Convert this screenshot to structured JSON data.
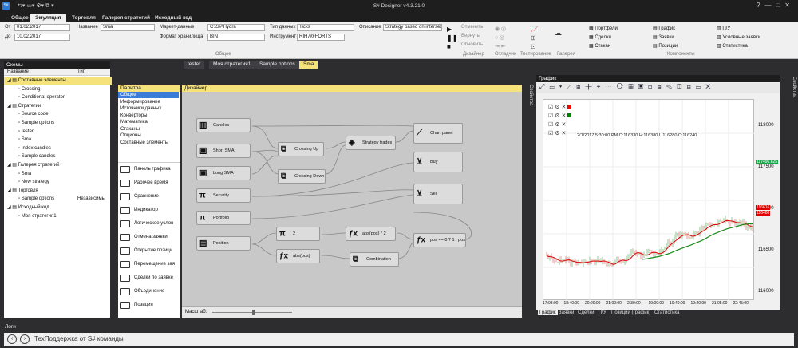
{
  "app": {
    "title": "S# Designer v4.3.21.0"
  },
  "menu_tabs": [
    "Общее",
    "Эмуляция",
    "Торговля",
    "Галерея стратегий",
    "Исходный код"
  ],
  "active_menu_tab": "Эмуляция",
  "ribbon": {
    "from_label": "От",
    "from_value": "01.02.2017",
    "to_label": "До",
    "to_value": "10.02.2017",
    "name_label": "Название",
    "name_value": "Sma",
    "market_data_label": "Маркет-данные",
    "market_data_value": "C:\\S#\\Hydra",
    "storage_format_label": "Формат хранилища",
    "storage_format_value": "BIN",
    "data_type_label": "Тип данных",
    "data_type_value": "Ticks",
    "instrument_label": "Инструмент",
    "instrument_value": "RIH7@FORTS",
    "description_label": "Описание",
    "description_value": "Strategy based on intersect",
    "general_group": "Общее",
    "cancel_label": "Отменить",
    "return_label": "Вернуть",
    "refresh_label": "Обновить",
    "designer_group": "Дизайнер",
    "debugger_group": "Отладчик",
    "testing_group": "Тестирование",
    "gallery_group": "Галерея",
    "components_group": "Компоненты",
    "components": [
      "Портфели",
      "График",
      "П/У",
      "Сделки",
      "Заявки",
      "Условные заявки",
      "Стакан",
      "Позиции",
      "Статистика"
    ]
  },
  "schemes_panel": {
    "title": "Схемы",
    "col_name": "Название",
    "col_type": "Тип",
    "rows": [
      {
        "label": "Составные элементы",
        "type": ""
      },
      {
        "label": "Crossing",
        "type": ""
      },
      {
        "label": "Conditional operator",
        "type": ""
      },
      {
        "label": "Стратегии",
        "type": ""
      },
      {
        "label": "Source code",
        "type": ""
      },
      {
        "label": "Sample options",
        "type": ""
      },
      {
        "label": "tester",
        "type": ""
      },
      {
        "label": "Sma",
        "type": ""
      },
      {
        "label": "Index candles",
        "type": ""
      },
      {
        "label": "Sample candles",
        "type": ""
      },
      {
        "label": "Галерея стратегий",
        "type": ""
      },
      {
        "label": "Sma",
        "type": ""
      },
      {
        "label": "New strategy",
        "type": ""
      },
      {
        "label": "Торговля",
        "type": ""
      },
      {
        "label": "Sample options",
        "type": "Независимы"
      },
      {
        "label": "Исходный код",
        "type": ""
      },
      {
        "label": "Моя стратегия1",
        "type": ""
      }
    ]
  },
  "doc_tabs": [
    "tester",
    "Моя стратегия1",
    "Sample options",
    "Sma"
  ],
  "active_doc_tab": "Sma",
  "palette": {
    "title": "Палитра",
    "categories": [
      "Общее",
      "Информирование",
      "Источники данных",
      "Конверторы",
      "Математика",
      "Стаканы",
      "Опционы",
      "Составные элементы"
    ],
    "items": [
      "Панель графика",
      "Рабочее время",
      "Сравнение",
      "Индикатор",
      "Логическое услов",
      "Отмена заявки",
      "Открытие позици",
      "Перемещение зая",
      "Сделки по заявке",
      "Объединение",
      "Позиция"
    ]
  },
  "designer": {
    "title": "Дизайнер",
    "scale_label": "Масштаб:",
    "nodes": {
      "candles": "Candles",
      "short_sma": "Short SMA",
      "long_sma": "Long SMA",
      "security": "Security",
      "portfolio": "Portfolio",
      "position": "Position",
      "crossing_up": "Crossing Up",
      "crossing_down": "Crossing Down",
      "strategy_trades": "Strategy trades",
      "chart_panel": "Chart panel",
      "buy": "Buy",
      "sell": "Sell",
      "pi2": "2",
      "abspos": "abs(pos)",
      "formula": "abs(pos) * 2",
      "combination": "Combination",
      "cond": "pos == 0 ? 1 : pos"
    }
  },
  "side_tabs": {
    "properties": "Свойства"
  },
  "chart": {
    "title": "График",
    "info": "2/1/2017 5:30:00 PM O:116330 H:116380 L:116280 C:116240",
    "x_ticks": [
      "17:03:00",
      "18:40:00",
      "20:20:00",
      "21:00:00",
      "2:30:00",
      "19:00:00",
      "10:40:00",
      "19:20:00",
      "21:05:00",
      "22:45:00"
    ],
    "y_ticks": [
      "118000",
      "117500",
      "117000",
      "116500",
      "116000"
    ],
    "price_tags": [
      "117496.625",
      "116616",
      "116480"
    ],
    "bottom_tabs": [
      "График",
      "Заявки",
      "Сделки",
      "П/У",
      "Позиции (график)",
      "Статистика"
    ],
    "legend_colors": [
      "#ff0000",
      "#008000"
    ]
  },
  "logs": {
    "title": "Логи",
    "input_text": "ТехПоддержка от S# команды"
  }
}
